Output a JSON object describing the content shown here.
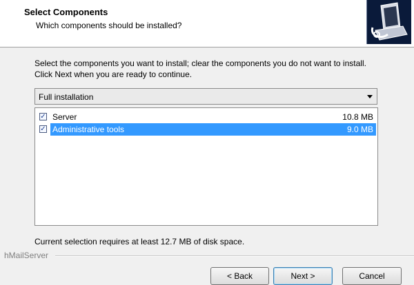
{
  "header": {
    "title": "Select Components",
    "subtitle": "Which components should be installed?"
  },
  "intro": "Select the components you want to install; clear the components you do not want to install. Click Next when you are ready to continue.",
  "setup_type": {
    "selected": "Full installation"
  },
  "components": [
    {
      "name": "Server",
      "size": "10.8 MB",
      "checked": true,
      "selected": false
    },
    {
      "name": "Administrative tools",
      "size": "9.0 MB",
      "checked": true,
      "selected": true
    }
  ],
  "disk_space": "Current selection requires at least 12.7 MB of disk space.",
  "brand": "hMailServer",
  "buttons": {
    "back": "< Back",
    "next": "Next >",
    "cancel": "Cancel"
  },
  "colors": {
    "selection": "#3399ff",
    "header_bg": "#ffffff",
    "dialog_bg": "#f0f0f0"
  }
}
